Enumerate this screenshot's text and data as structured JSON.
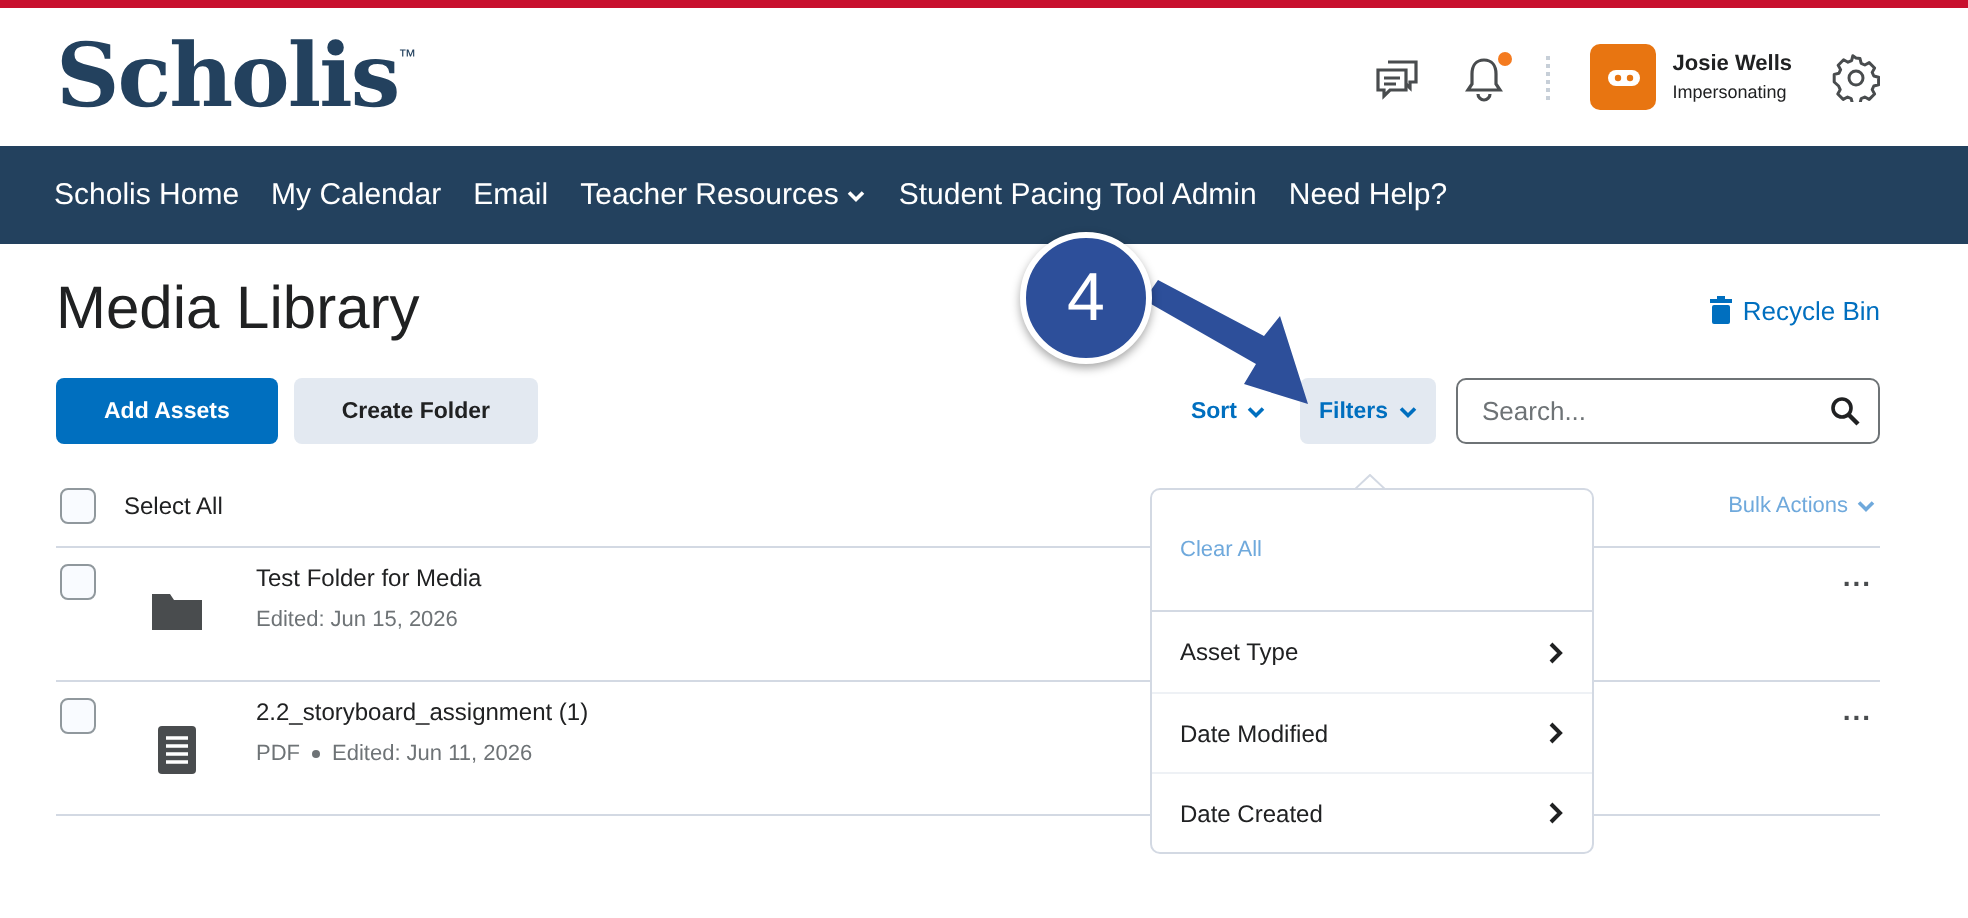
{
  "brand": {
    "name": "Scholis",
    "mark": "™"
  },
  "header": {
    "notification_unread": true,
    "user": {
      "name": "Josie Wells",
      "role": "Impersonating"
    }
  },
  "nav": [
    {
      "label": "Scholis Home",
      "has_menu": false
    },
    {
      "label": "My Calendar",
      "has_menu": false
    },
    {
      "label": "Email",
      "has_menu": false
    },
    {
      "label": "Teacher Resources",
      "has_menu": true
    },
    {
      "label": "Student Pacing Tool Admin",
      "has_menu": false
    },
    {
      "label": "Need Help?",
      "has_menu": false
    }
  ],
  "page": {
    "title": "Media Library",
    "recycle_bin": "Recycle Bin"
  },
  "toolbar": {
    "buttons": [
      {
        "label": "Add Assets",
        "kind": "primary"
      },
      {
        "label": "Create Folder",
        "kind": "secondary"
      }
    ],
    "sort": "Sort",
    "filters": {
      "label": "Filters",
      "expanded": true
    },
    "search": {
      "placeholder": "Search..."
    }
  },
  "list": {
    "select_all": {
      "label": "Select All",
      "checked": false
    },
    "bulk_actions": "Bulk Actions",
    "items": [
      {
        "kind": "folder",
        "name": "Test Folder for Media",
        "meta": [
          "Edited: Jun 15, 2026"
        ],
        "checked": false,
        "more": "..."
      },
      {
        "kind": "document",
        "name": "2.2_storyboard_assignment (1)",
        "meta": [
          "PDF",
          "Edited: Jun 11, 2026"
        ],
        "checked": false,
        "more": "..."
      }
    ]
  },
  "filter_menu": {
    "clear_all": "Clear All",
    "options": [
      "Asset Type",
      "Date Modified",
      "Date Created"
    ]
  },
  "callout": {
    "number": "4"
  }
}
